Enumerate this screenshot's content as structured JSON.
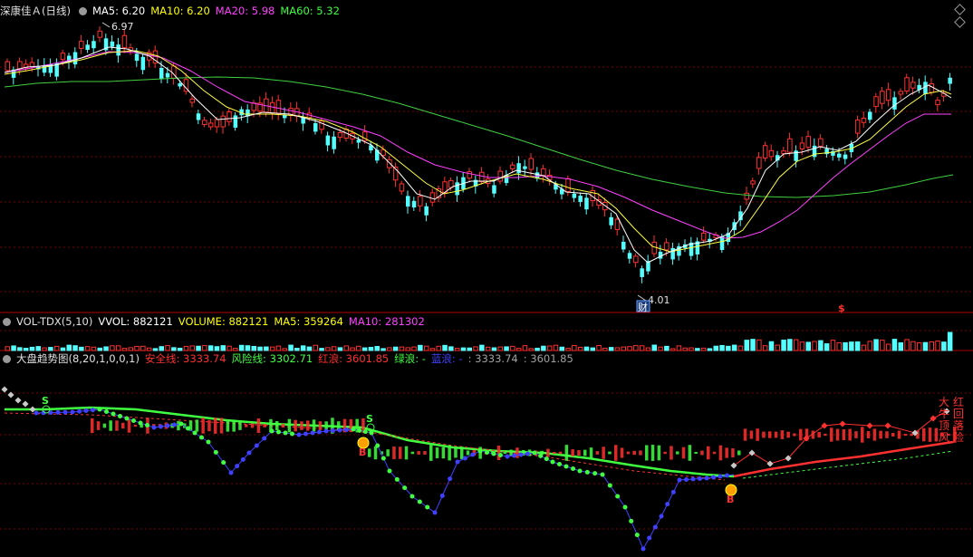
{
  "main_panel": {
    "stock_name": "深康佳Ａ",
    "period": "(日线)",
    "ma5": {
      "label": "MA5: 6.20",
      "color": "#ffffff"
    },
    "ma10": {
      "label": "MA10: 6.20",
      "color": "#ffff00"
    },
    "ma20": {
      "label": "MA20: 5.98",
      "color": "#ff40ff"
    },
    "ma60": {
      "label": "MA60: 5.32",
      "color": "#40ff40"
    },
    "high_marker": "6.97",
    "low_marker": "4.01",
    "finance_badge": "财",
    "dividend_badge": "$"
  },
  "volume_panel": {
    "name": "VOL-TDX(5,10)",
    "vvol": "VVOL: 882121",
    "volume": "VOLUME: 882121",
    "ma5": "MA5: 359264",
    "ma10": "MA10: 281302",
    "colors": {
      "vvol": "#ffffff",
      "volume": "#ffff00",
      "ma5": "#ffff00",
      "ma10": "#ff40ff"
    }
  },
  "indicator_panel": {
    "name": "大盘趋势图(8,20,1,0,0,1)",
    "safe_line": "安全线: 3333.74",
    "risk_line": "风险线: 3302.71",
    "red_wave": "红浪: 3601.85",
    "green_wave": "绿浪: -",
    "blue_wave": "蓝浪: -",
    "val1": ": 3333.74",
    "val2": ": 3601.85",
    "colors": {
      "safe": "#ff3030",
      "risk": "#40ff40",
      "red": "#ff3030",
      "green": "#40ff40",
      "blue": "#4040ff",
      "gray": "#a0a0a0"
    },
    "signal_s": "S",
    "signal_b": "B",
    "vertical_text": [
      "大",
      "红",
      "牛",
      "回",
      "顶",
      "落",
      "风",
      "险"
    ]
  }
}
